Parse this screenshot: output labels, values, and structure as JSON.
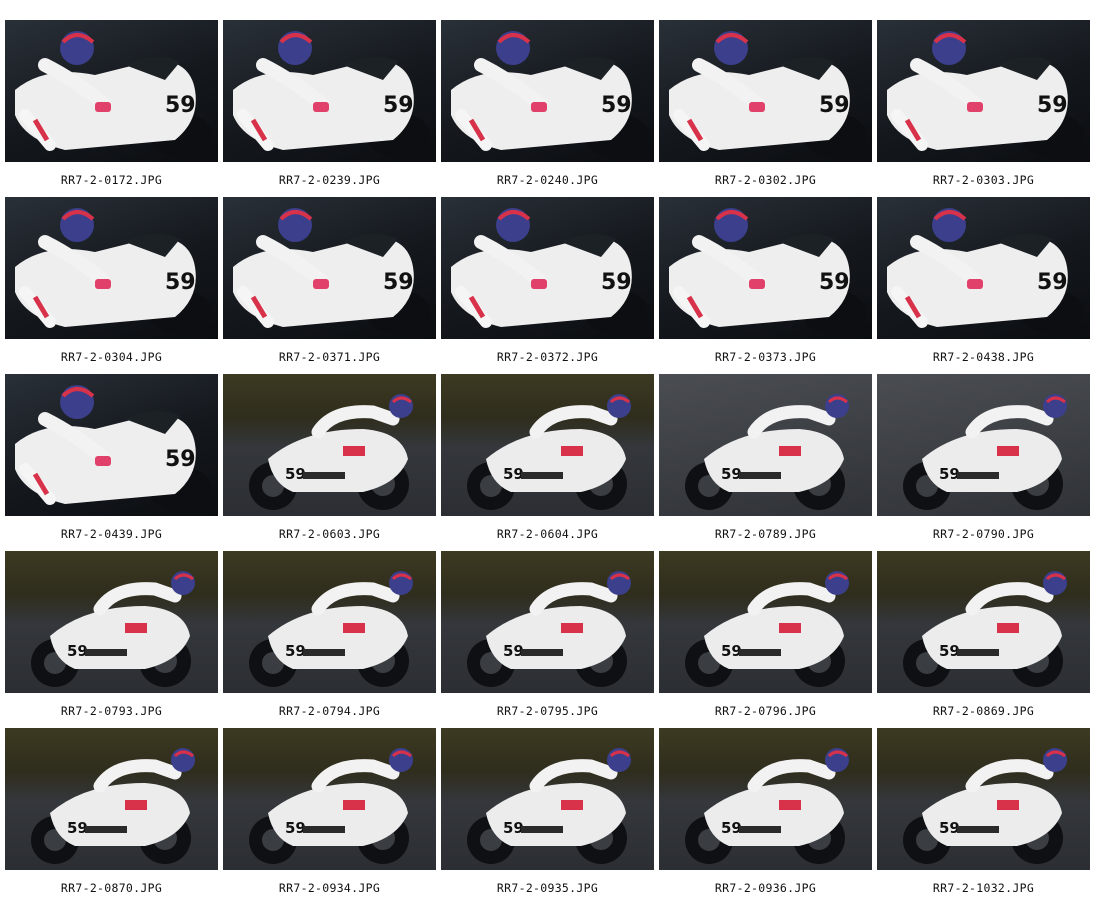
{
  "gallery": {
    "items": [
      {
        "filename": "RR7-2-0172.JPG",
        "icon": "photo-thumbnail",
        "scene": "closeup"
      },
      {
        "filename": "RR7-2-0239.JPG",
        "icon": "photo-thumbnail",
        "scene": "closeup"
      },
      {
        "filename": "RR7-2-0240.JPG",
        "icon": "photo-thumbnail",
        "scene": "closeup"
      },
      {
        "filename": "RR7-2-0302.JPG",
        "icon": "photo-thumbnail",
        "scene": "closeup"
      },
      {
        "filename": "RR7-2-0303.JPG",
        "icon": "photo-thumbnail",
        "scene": "closeup"
      },
      {
        "filename": "RR7-2-0304.JPG",
        "icon": "photo-thumbnail",
        "scene": "closeup"
      },
      {
        "filename": "RR7-2-0371.JPG",
        "icon": "photo-thumbnail",
        "scene": "closeup"
      },
      {
        "filename": "RR7-2-0372.JPG",
        "icon": "photo-thumbnail",
        "scene": "closeup"
      },
      {
        "filename": "RR7-2-0373.JPG",
        "icon": "photo-thumbnail",
        "scene": "closeup"
      },
      {
        "filename": "RR7-2-0438.JPG",
        "icon": "photo-thumbnail",
        "scene": "closeup"
      },
      {
        "filename": "RR7-2-0439.JPG",
        "icon": "photo-thumbnail",
        "scene": "closeup"
      },
      {
        "filename": "RR7-2-0603.JPG",
        "icon": "photo-thumbnail",
        "scene": "green"
      },
      {
        "filename": "RR7-2-0604.JPG",
        "icon": "photo-thumbnail",
        "scene": "green"
      },
      {
        "filename": "RR7-2-0789.JPG",
        "icon": "photo-thumbnail",
        "scene": "grey"
      },
      {
        "filename": "RR7-2-0790.JPG",
        "icon": "photo-thumbnail",
        "scene": "grey"
      },
      {
        "filename": "RR7-2-0793.JPG",
        "icon": "photo-thumbnail",
        "scene": "green"
      },
      {
        "filename": "RR7-2-0794.JPG",
        "icon": "photo-thumbnail",
        "scene": "green"
      },
      {
        "filename": "RR7-2-0795.JPG",
        "icon": "photo-thumbnail",
        "scene": "green"
      },
      {
        "filename": "RR7-2-0796.JPG",
        "icon": "photo-thumbnail",
        "scene": "green"
      },
      {
        "filename": "RR7-2-0869.JPG",
        "icon": "photo-thumbnail",
        "scene": "green"
      },
      {
        "filename": "RR7-2-0870.JPG",
        "icon": "photo-thumbnail",
        "scene": "green"
      },
      {
        "filename": "RR7-2-0934.JPG",
        "icon": "photo-thumbnail",
        "scene": "green"
      },
      {
        "filename": "RR7-2-0935.JPG",
        "icon": "photo-thumbnail",
        "scene": "green"
      },
      {
        "filename": "RR7-2-0936.JPG",
        "icon": "photo-thumbnail",
        "scene": "green"
      },
      {
        "filename": "RR7-2-1032.JPG",
        "icon": "photo-thumbnail",
        "scene": "green"
      }
    ],
    "colors": {
      "background": "#ffffff",
      "caption_text": "#111111",
      "bike_white": "#eeeeee",
      "accent_red": "#d8324a",
      "helmet": "#3b3f8c"
    }
  }
}
